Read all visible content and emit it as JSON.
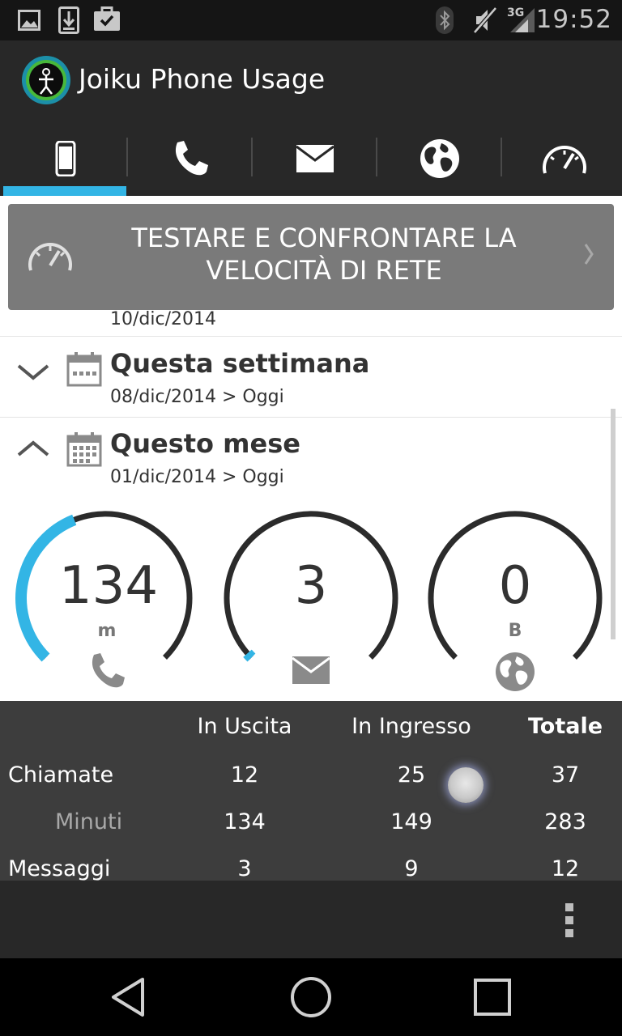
{
  "status_bar": {
    "time": "19:52",
    "network_type": "3G",
    "left_icons": [
      "image-icon",
      "download-icon",
      "briefcase-check-icon"
    ],
    "right_icons": [
      "bluetooth-icon",
      "mute-icon",
      "signal-icon"
    ]
  },
  "app": {
    "title": "Joiku Phone Usage"
  },
  "tabs": [
    {
      "icon": "phone-device-icon",
      "selected": true
    },
    {
      "icon": "phone-call-icon",
      "selected": false
    },
    {
      "icon": "envelope-icon",
      "selected": false
    },
    {
      "icon": "globe-icon",
      "selected": false
    },
    {
      "icon": "speedometer-icon",
      "selected": false
    }
  ],
  "banner": {
    "line1": "TESTARE E CONFRONTARE LA",
    "line2": "VELOCITÀ DI RETE"
  },
  "periods": {
    "previous_range": "10/dic/2014",
    "week": {
      "title": "Questa settimana",
      "range": "08/dic/2014 > Oggi",
      "expanded": false
    },
    "month": {
      "title": "Questo mese",
      "range": "01/dic/2014 > Oggi",
      "expanded": true
    }
  },
  "gauges": [
    {
      "value": "134",
      "unit": "m",
      "icon": "phone-call-icon",
      "fill_fraction": 0.42
    },
    {
      "value": "3",
      "unit": "",
      "icon": "envelope-icon",
      "fill_fraction": 0.01
    },
    {
      "value": "0",
      "unit": "B",
      "icon": "globe-icon",
      "fill_fraction": 0.0
    }
  ],
  "stats": {
    "headers": {
      "outgoing": "In Uscita",
      "incoming": "In Ingresso",
      "total": "Totale"
    },
    "rows": [
      {
        "label": "Chiamate",
        "outgoing": "12",
        "incoming": "25",
        "total": "37"
      },
      {
        "label": "Minuti",
        "outgoing": "134",
        "incoming": "149",
        "total": "283"
      },
      {
        "label": "Messaggi",
        "outgoing": "3",
        "incoming": "9",
        "total": "12"
      }
    ]
  },
  "colors": {
    "accent": "#33b5e5",
    "status_bar": "#151515",
    "action_bar": "#282828",
    "banner": "#7a7a7a",
    "stats_bg": "#3d3d3d",
    "gauge_track": "#2b2b2b"
  }
}
